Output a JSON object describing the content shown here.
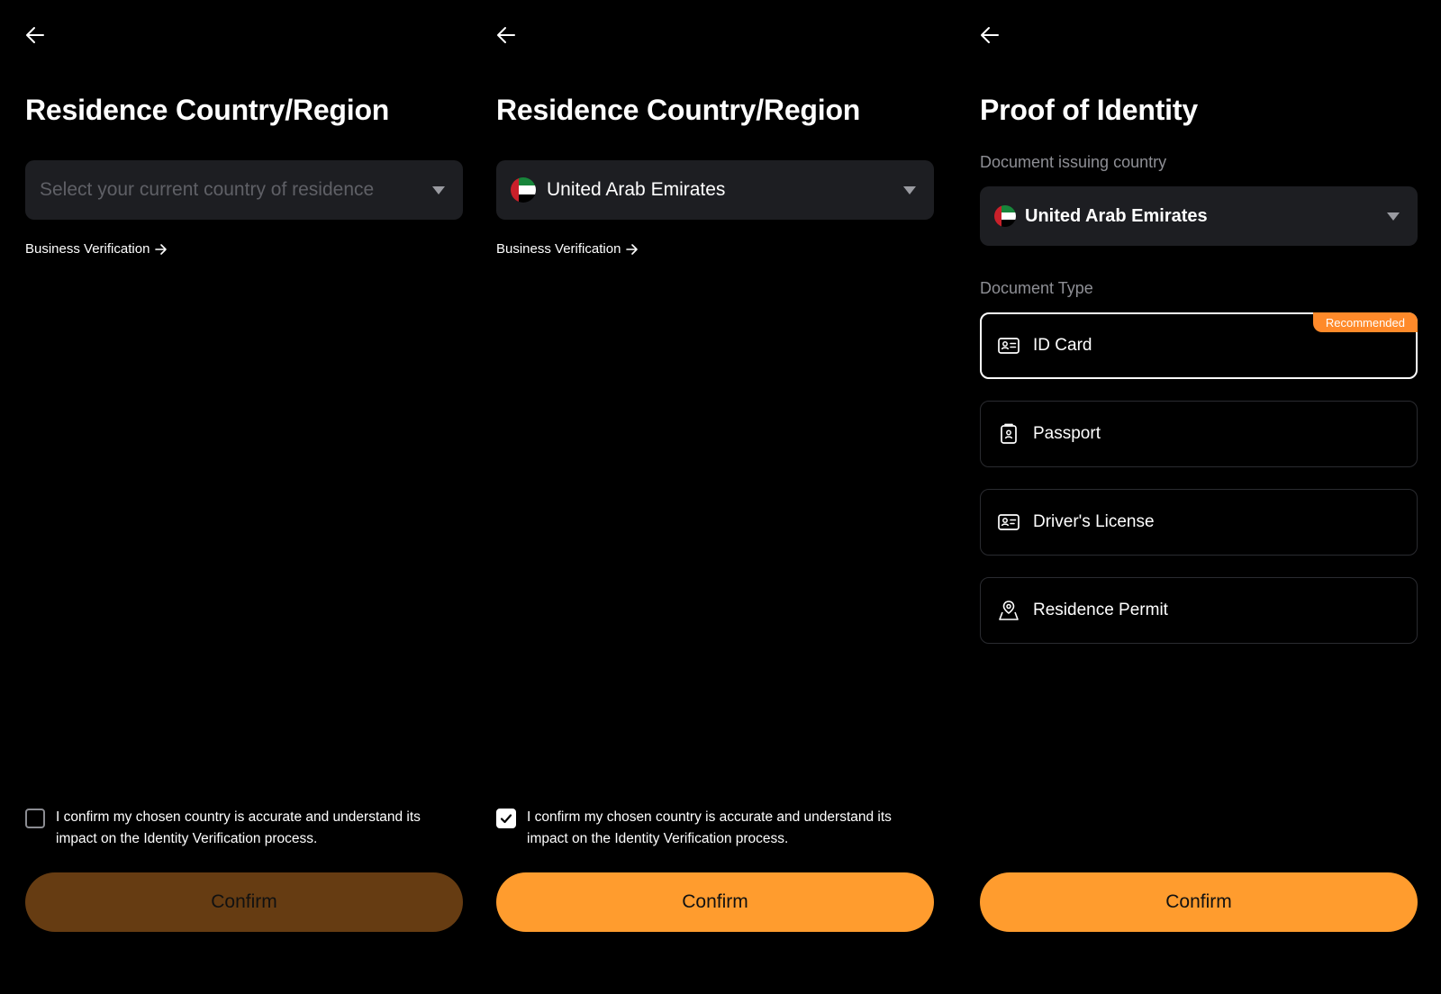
{
  "screens": [
    {
      "title": "Residence Country/Region",
      "select_placeholder": "Select your current country of residence",
      "business_link": "Business Verification",
      "confirm_text": "I confirm my chosen country is accurate and understand its impact on the Identity Verification process.",
      "confirm_checked": false,
      "button_label": "Confirm",
      "button_state": "disabled"
    },
    {
      "title": "Residence Country/Region",
      "select_value": "United Arab Emirates",
      "business_link": "Business Verification",
      "confirm_text": "I confirm my chosen country is accurate and understand its impact on the Identity Verification process.",
      "confirm_checked": true,
      "button_label": "Confirm",
      "button_state": "enabled"
    },
    {
      "title": "Proof of Identity",
      "issuing_label": "Document issuing country",
      "select_value": "United Arab Emirates",
      "doc_type_label": "Document Type",
      "documents": [
        {
          "label": "ID Card",
          "icon": "id-card-icon",
          "selected": true,
          "badge": "Recommended"
        },
        {
          "label": "Passport",
          "icon": "passport-icon",
          "selected": false
        },
        {
          "label": "Driver's License",
          "icon": "drivers-license-icon",
          "selected": false
        },
        {
          "label": "Residence Permit",
          "icon": "residence-permit-icon",
          "selected": false
        }
      ],
      "button_label": "Confirm",
      "button_state": "enabled"
    }
  ],
  "colors": {
    "background": "#000000",
    "field": "#1d1e22",
    "accent": "#ff9c2e",
    "accent_disabled": "#663c12",
    "badge": "#ff8a2a",
    "muted_text": "#8e8f95"
  }
}
